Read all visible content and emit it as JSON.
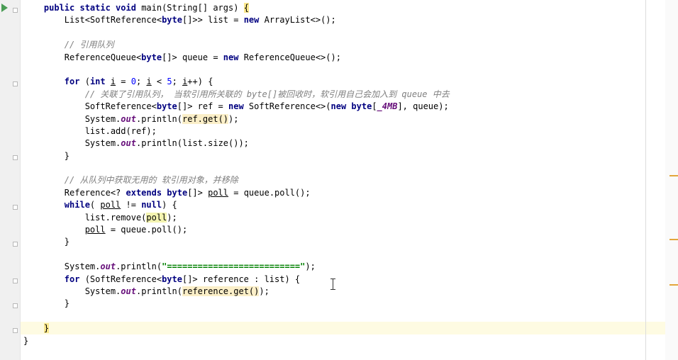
{
  "editor": {
    "language": "java",
    "lines": [
      {
        "id": "l1",
        "parts": [
          [
            "    ",
            ""
          ],
          [
            "public static void ",
            "kw"
          ],
          [
            "main(String[] args) ",
            ""
          ],
          [
            "{",
            "brace-hl"
          ]
        ]
      },
      {
        "id": "l2",
        "parts": [
          [
            "        List<SoftReference<",
            ""
          ],
          [
            "byte",
            "kw"
          ],
          [
            "[]>> list = ",
            ""
          ],
          [
            "new ",
            "kw"
          ],
          [
            "ArrayList<>();",
            ""
          ]
        ]
      },
      {
        "id": "l3",
        "parts": []
      },
      {
        "id": "l4",
        "parts": [
          [
            "        ",
            ""
          ],
          [
            "// 引用队列",
            "cm"
          ]
        ]
      },
      {
        "id": "l5",
        "parts": [
          [
            "        ReferenceQueue<",
            ""
          ],
          [
            "byte",
            "kw"
          ],
          [
            "[]> queue = ",
            ""
          ],
          [
            "new ",
            "kw"
          ],
          [
            "ReferenceQueue<>();",
            ""
          ]
        ]
      },
      {
        "id": "l6",
        "parts": []
      },
      {
        "id": "l7",
        "parts": [
          [
            "        ",
            ""
          ],
          [
            "for ",
            "kw"
          ],
          [
            "(",
            ""
          ],
          [
            "int ",
            "kw"
          ],
          [
            "i",
            "u"
          ],
          [
            " = ",
            ""
          ],
          [
            "0",
            "num"
          ],
          [
            "; ",
            ""
          ],
          [
            "i",
            "u"
          ],
          [
            " < ",
            ""
          ],
          [
            "5",
            "num"
          ],
          [
            "; ",
            ""
          ],
          [
            "i",
            "u"
          ],
          [
            "++) {",
            ""
          ]
        ]
      },
      {
        "id": "l8",
        "parts": [
          [
            "            ",
            ""
          ],
          [
            "// 关联了引用队列， 当软引用所关联的 byte[]被回收时，软引用自己会加入到 queue 中去",
            "cm"
          ]
        ]
      },
      {
        "id": "l9",
        "parts": [
          [
            "            SoftReference<",
            ""
          ],
          [
            "byte",
            "kw"
          ],
          [
            "[]> ref = ",
            ""
          ],
          [
            "new ",
            "kw"
          ],
          [
            "SoftReference<>(",
            ""
          ],
          [
            "new ",
            "kw"
          ],
          [
            "byte",
            "kw"
          ],
          [
            "[",
            ""
          ],
          [
            "_4MB",
            "st"
          ],
          [
            "], queue);",
            ""
          ]
        ]
      },
      {
        "id": "l10",
        "parts": [
          [
            "            System.",
            ""
          ],
          [
            "out",
            "st"
          ],
          [
            ".println(",
            ""
          ],
          [
            "ref.get()",
            "hl"
          ],
          [
            ");",
            ""
          ]
        ]
      },
      {
        "id": "l11",
        "parts": [
          [
            "            list.add(ref);",
            ""
          ]
        ]
      },
      {
        "id": "l12",
        "parts": [
          [
            "            System.",
            ""
          ],
          [
            "out",
            "st"
          ],
          [
            ".println(list.size());",
            ""
          ]
        ]
      },
      {
        "id": "l13",
        "parts": [
          [
            "        }",
            ""
          ]
        ]
      },
      {
        "id": "l14",
        "parts": []
      },
      {
        "id": "l15",
        "parts": [
          [
            "        ",
            ""
          ],
          [
            "// 从队列中获取无用的 软引用对象，并移除",
            "cm"
          ]
        ]
      },
      {
        "id": "l16",
        "parts": [
          [
            "        Reference<? ",
            ""
          ],
          [
            "extends ",
            "kw"
          ],
          [
            "byte",
            "kw"
          ],
          [
            "[]> ",
            ""
          ],
          [
            "poll",
            "u"
          ],
          [
            " = queue.poll();",
            ""
          ]
        ]
      },
      {
        "id": "l17",
        "parts": [
          [
            "        ",
            ""
          ],
          [
            "while",
            "kw"
          ],
          [
            "( ",
            ""
          ],
          [
            "poll",
            "u"
          ],
          [
            " != ",
            ""
          ],
          [
            "null",
            "kw"
          ],
          [
            ") {",
            ""
          ]
        ]
      },
      {
        "id": "l18",
        "parts": [
          [
            "            list.remove(",
            ""
          ],
          [
            "poll",
            "hl2"
          ],
          [
            ");",
            ""
          ]
        ]
      },
      {
        "id": "l19",
        "parts": [
          [
            "            ",
            ""
          ],
          [
            "poll",
            "u"
          ],
          [
            " = queue.poll();",
            ""
          ]
        ]
      },
      {
        "id": "l20",
        "parts": [
          [
            "        }",
            ""
          ]
        ]
      },
      {
        "id": "l21",
        "parts": []
      },
      {
        "id": "l22",
        "parts": [
          [
            "        System.",
            ""
          ],
          [
            "out",
            "st"
          ],
          [
            ".println(",
            ""
          ],
          [
            "\"==========================\"",
            "str"
          ],
          [
            ");",
            ""
          ]
        ]
      },
      {
        "id": "l23",
        "parts": [
          [
            "        ",
            ""
          ],
          [
            "for ",
            "kw"
          ],
          [
            "(SoftReference<",
            ""
          ],
          [
            "byte",
            "kw"
          ],
          [
            "[]> reference : list) {",
            ""
          ]
        ]
      },
      {
        "id": "l24",
        "parts": [
          [
            "            System.",
            ""
          ],
          [
            "out",
            "st"
          ],
          [
            ".println(",
            ""
          ],
          [
            "reference.get()",
            "hl"
          ],
          [
            ");",
            ""
          ]
        ]
      },
      {
        "id": "l25",
        "parts": [
          [
            "        }",
            ""
          ]
        ]
      },
      {
        "id": "l26",
        "parts": []
      },
      {
        "id": "l27",
        "parts": [
          [
            "    ",
            ""
          ],
          [
            "}",
            "brace-hl"
          ]
        ]
      },
      {
        "id": "l28",
        "parts": [
          [
            "}",
            ""
          ]
        ]
      }
    ]
  },
  "gutter_icons": [
    "run-icon",
    "fold-icon"
  ],
  "scroll_markers": [
    "warning",
    "warning",
    "warning"
  ],
  "colors": {
    "keyword": "#000080",
    "comment": "#808080",
    "number": "#0000ff",
    "string": "#008000",
    "static_field": "#660e7a",
    "usage_highlight": "#fbefc8",
    "caret_row": "#fefbe2",
    "marker": "#e3a63c",
    "run_icon": "#499c54"
  }
}
